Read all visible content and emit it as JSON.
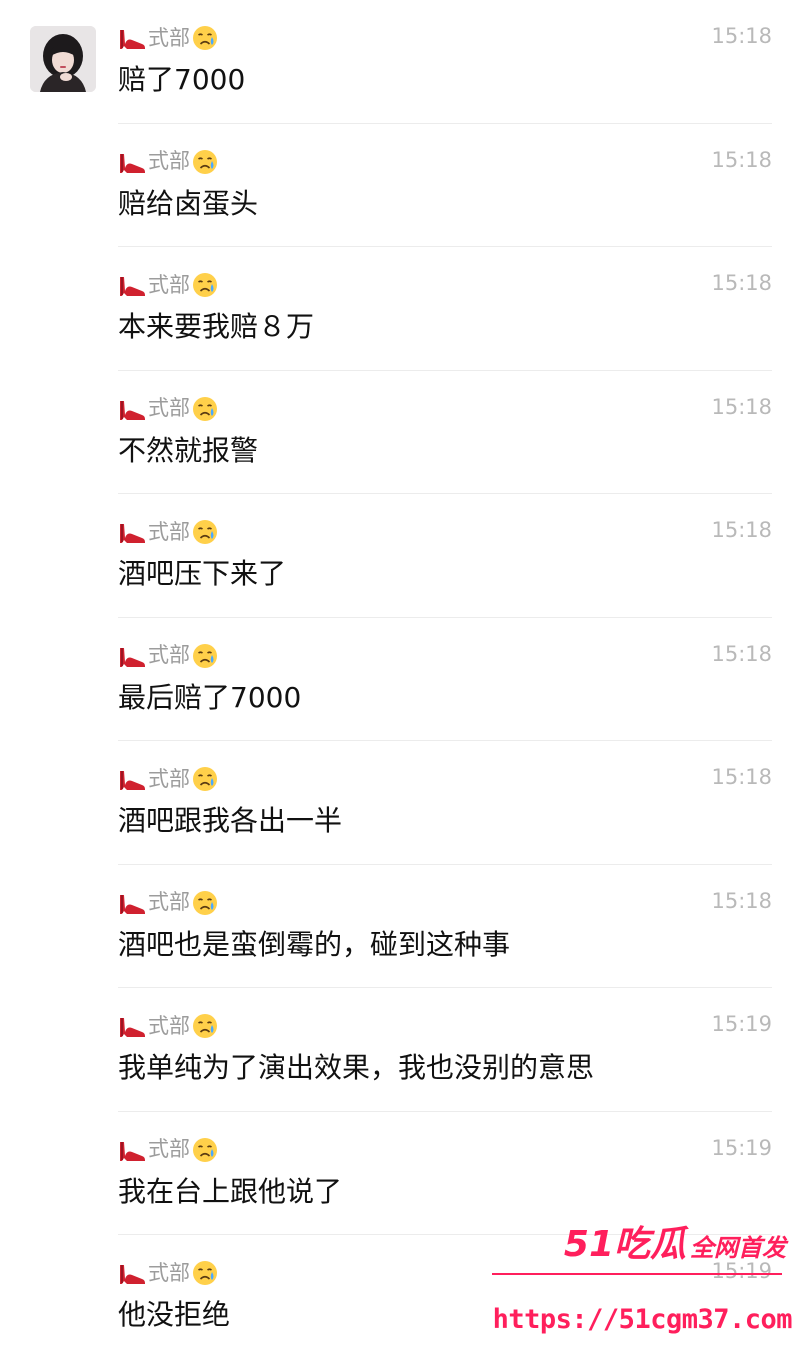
{
  "chat": {
    "sender_name": "式部",
    "messages": [
      {
        "time": "15:18",
        "text": "赔了7000"
      },
      {
        "time": "15:18",
        "text": "赔给卤蛋头"
      },
      {
        "time": "15:18",
        "text": "本来要我赔８万"
      },
      {
        "time": "15:18",
        "text": "不然就报警"
      },
      {
        "time": "15:18",
        "text": "酒吧压下来了"
      },
      {
        "time": "15:18",
        "text": "最后赔了7000"
      },
      {
        "time": "15:18",
        "text": "酒吧跟我各出一半"
      },
      {
        "time": "15:18",
        "text": "酒吧也是蛮倒霉的，碰到这种事"
      },
      {
        "time": "15:19",
        "text": "我单纯为了演出效果，我也没别的意思"
      },
      {
        "time": "15:19",
        "text": "我在台上跟他说了"
      },
      {
        "time": "15:19",
        "text": "他没拒绝"
      }
    ]
  },
  "icons": {
    "sender_prefix": "high-heel-icon",
    "sender_suffix": "crying-face-icon"
  },
  "watermark": {
    "brand": "51吃瓜",
    "tagline": "全网首发",
    "url": "https://51cgm37.com"
  },
  "colors": {
    "sender_name": "#9c9c9c",
    "time": "#b9b9b9",
    "message_text": "#111111",
    "divider": "#ececec",
    "watermark": "#ff1f5c"
  }
}
